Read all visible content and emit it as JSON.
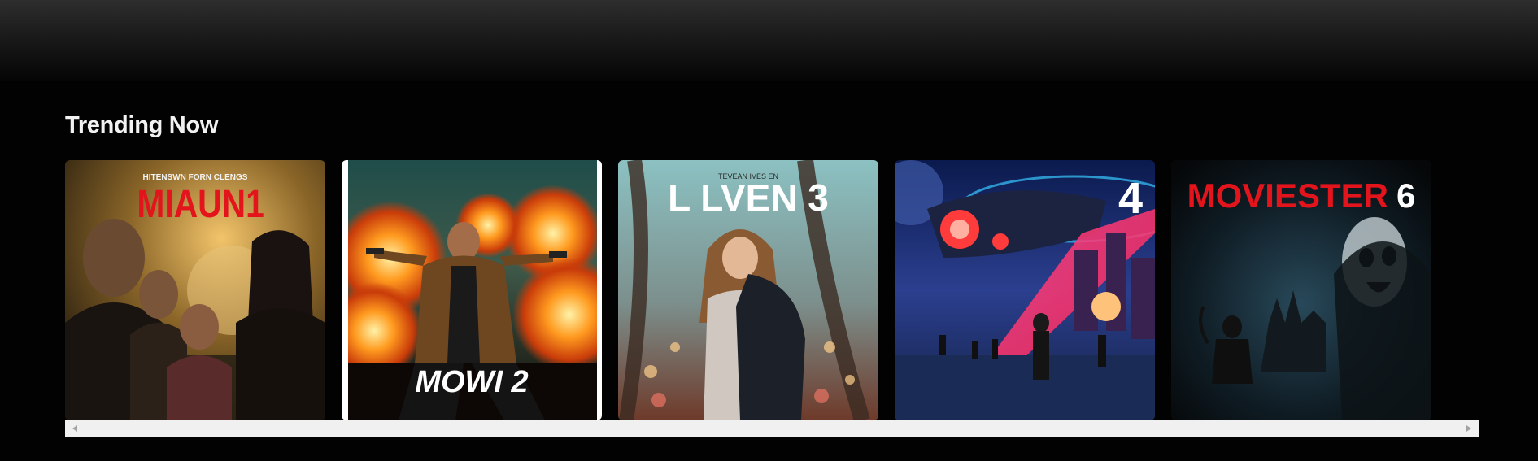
{
  "header": {
    "title": ""
  },
  "trending": {
    "title": "Trending Now",
    "cards": [
      {
        "id": "card-1",
        "kicker": "HITENSWN   FORN      CLENGS",
        "title": "MIAUN1",
        "title_color": "#e3141b"
      },
      {
        "id": "card-2",
        "kicker": "",
        "title": "MOWI 2",
        "title_color": "#ffffff"
      },
      {
        "id": "card-3",
        "kicker": "TEVEAN IVES EN",
        "title": "L LVEN 3",
        "title_color": "#ffffff"
      },
      {
        "id": "card-4",
        "kicker": "",
        "title": "4",
        "title_color": "#ffffff"
      },
      {
        "id": "card-5",
        "kicker": "",
        "title": "MOVIESTER",
        "title_number": "6",
        "title_color": "#e3141b"
      }
    ]
  },
  "scrollbar": {
    "left_arrow": "scroll-left-arrow-icon",
    "right_arrow": "scroll-right-arrow-icon"
  }
}
